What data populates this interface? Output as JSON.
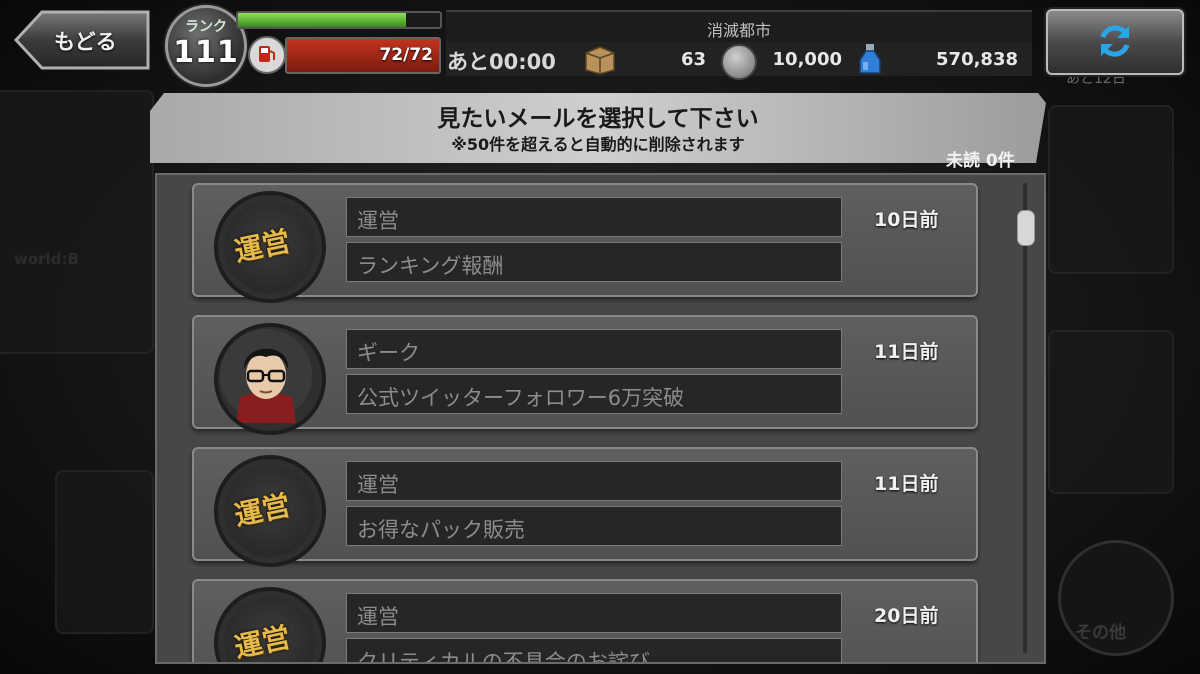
{
  "topbar": {
    "back_label": "もどる",
    "rank_label": "ランク",
    "rank_value": "111",
    "xp_progress": 0.83,
    "stamina_text": "72/72",
    "stamina_fraction": 1.0,
    "location": "消滅都市",
    "timer": "あと00:00",
    "box_count": "63",
    "coin_count": "10,000",
    "potion_count": "570,838",
    "icons": {
      "back": "left-arrow-icon",
      "fuel": "fuel-pump-icon",
      "box": "cardboard-box-icon",
      "coin": "coin-icon",
      "potion": "potion-bottle-icon",
      "refresh": "refresh-icon"
    },
    "behind_text": "あと12日"
  },
  "header": {
    "title": "見たいメールを選択して下さい",
    "subtitle": "※50件を超えると自動的に削除されます",
    "unread": "未読 0件"
  },
  "mails": [
    {
      "avatar": "unei",
      "sender": "運営",
      "subject": "ランキング報酬",
      "date": "10日前"
    },
    {
      "avatar": "geek",
      "sender": "ギーク",
      "subject": "公式ツイッターフォロワー6万突破",
      "date": "11日前"
    },
    {
      "avatar": "unei",
      "sender": "運営",
      "subject": "お得なパック販売",
      "date": "11日前"
    },
    {
      "avatar": "unei",
      "sender": "運営",
      "subject": "クリティカルの不具合のお詫び",
      "date": "20日前"
    }
  ],
  "avatar_labels": {
    "unei": "運営"
  },
  "background": {
    "world_label": "world:B",
    "other_label": "その他"
  },
  "colors": {
    "accent_gold": "#e5b94a",
    "stamina_red": "#c2331f",
    "xp_green": "#8ee05c",
    "refresh_blue": "#2aa6e8"
  }
}
